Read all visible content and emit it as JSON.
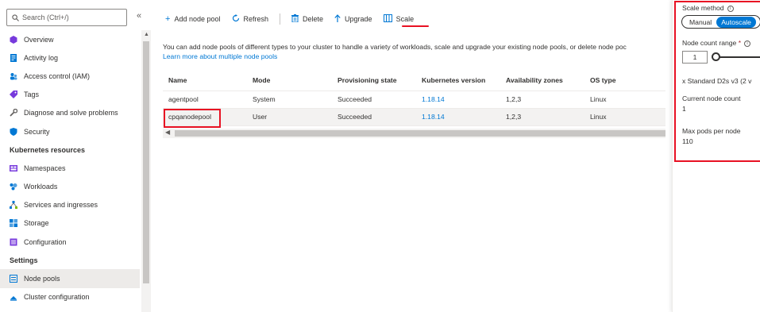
{
  "sidebar": {
    "search_placeholder": "Search (Ctrl+/)",
    "collapse_glyph": "«",
    "items": [
      {
        "label": "Overview",
        "icon": "overview-icon"
      },
      {
        "label": "Activity log",
        "icon": "activity-log-icon"
      },
      {
        "label": "Access control (IAM)",
        "icon": "access-control-icon"
      },
      {
        "label": "Tags",
        "icon": "tag-icon"
      },
      {
        "label": "Diagnose and solve problems",
        "icon": "wrench-icon"
      },
      {
        "label": "Security",
        "icon": "shield-icon"
      }
    ],
    "section_kubernetes": "Kubernetes resources",
    "kube_items": [
      {
        "label": "Namespaces",
        "icon": "namespaces-icon"
      },
      {
        "label": "Workloads",
        "icon": "workloads-icon"
      },
      {
        "label": "Services and ingresses",
        "icon": "services-icon"
      },
      {
        "label": "Storage",
        "icon": "storage-icon"
      },
      {
        "label": "Configuration",
        "icon": "configuration-icon"
      }
    ],
    "section_settings": "Settings",
    "settings_items": [
      {
        "label": "Node pools",
        "icon": "node-pools-icon",
        "active": true
      },
      {
        "label": "Cluster configuration",
        "icon": "cluster-configuration-icon"
      }
    ]
  },
  "toolbar": {
    "add_label": "Add node pool",
    "refresh_label": "Refresh",
    "delete_label": "Delete",
    "upgrade_label": "Upgrade",
    "scale_label": "Scale"
  },
  "main": {
    "description": "You can add node pools of different types to your cluster to handle a variety of workloads, scale and upgrade your existing node pools, or delete node poc",
    "learn_more": "Learn more about multiple node pools",
    "columns": [
      "Name",
      "Mode",
      "Provisioning state",
      "Kubernetes version",
      "Availability zones",
      "OS type"
    ],
    "rows": [
      {
        "name": "agentpool",
        "mode": "System",
        "state": "Succeeded",
        "version": "1.18.14",
        "zones": "1,2,3",
        "os": "Linux"
      },
      {
        "name": "cpqanodepool",
        "mode": "User",
        "state": "Succeeded",
        "version": "1.18.14",
        "zones": "1,2,3",
        "os": "Linux",
        "selected": true
      }
    ]
  },
  "panel": {
    "scale_method_label": "Scale method",
    "scale_options": [
      "Manual",
      "Autoscale"
    ],
    "scale_selected": "Autoscale",
    "node_count_label": "Node count range",
    "required_marker": "*",
    "node_count_value": "1",
    "vm_size_text": "x Standard D2s v3 (2 v",
    "current_node_count_label": "Current node count",
    "current_node_count_value": "1",
    "max_pods_label": "Max pods per node",
    "max_pods_value": "110"
  },
  "colors": {
    "accent": "#0078d4",
    "highlight_red": "#e81123",
    "text": "#323130",
    "selected_row": "#f3f2f1"
  }
}
